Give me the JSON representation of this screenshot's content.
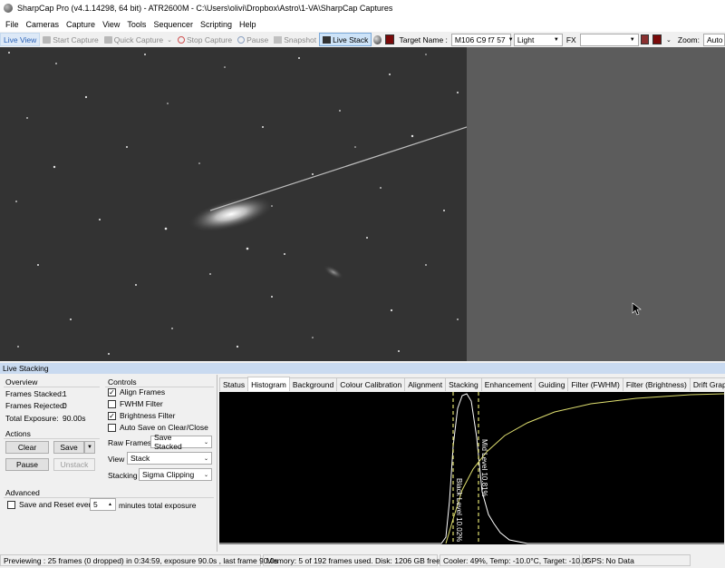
{
  "window": {
    "title": "SharpCap Pro (v4.1.14298, 64 bit) - ATR2600M - C:\\Users\\olivi\\Dropbox\\Astro\\1-VA\\SharpCap Captures"
  },
  "menu": [
    "File",
    "Cameras",
    "Capture",
    "View",
    "Tools",
    "Sequencer",
    "Scripting",
    "Help"
  ],
  "toolbar": {
    "live_view": "Live View",
    "start_capture": "Start Capture",
    "quick_capture": "Quick Capture",
    "stop_capture": "Stop Capture",
    "pause": "Pause",
    "snapshot": "Snapshot",
    "live_stack": "Live Stack",
    "target_name_label": "Target Name :",
    "target_name_value": "M106 C9 f7 57",
    "frame_type": "Light",
    "fx_label": "FX",
    "fx_value": "",
    "zoom_label": "Zoom:",
    "zoom_value": "Auto"
  },
  "live_stacking": {
    "title": "Live Stacking",
    "overview": {
      "heading": "Overview",
      "frames_stacked_label": "Frames Stacked:",
      "frames_stacked": "1",
      "frames_rejected_label": "Frames Rejected:",
      "frames_rejected": "0",
      "total_exposure_label": "Total Exposure:",
      "total_exposure": "90.00s"
    },
    "actions": {
      "heading": "Actions",
      "clear": "Clear",
      "save": "Save",
      "pause": "Pause",
      "unstack": "Unstack"
    },
    "controls": {
      "heading": "Controls",
      "align_frames": "Align Frames",
      "fwhm_filter": "FWHM Filter",
      "brightness_filter": "Brightness Filter",
      "auto_save": "Auto Save on Clear/Close",
      "raw_frames_label": "Raw Frames",
      "raw_frames_value": "Save Stacked",
      "view_label": "View",
      "view_value": "Stack",
      "stacking_label": "Stacking",
      "stacking_value": "Sigma Clipping"
    },
    "advanced": {
      "heading": "Advanced",
      "save_reset_label": "Save and Reset every",
      "save_reset_value": "5",
      "minutes_label": "minutes total exposure"
    },
    "tabs": [
      "Status",
      "Histogram",
      "Background",
      "Colour Calibration",
      "Alignment",
      "Stacking",
      "Enhancement",
      "Guiding",
      "Filter (FWHM)",
      "Filter (Brightness)",
      "Drift Graph"
    ],
    "selected_tab": "Histogram",
    "histogram": {
      "black_level_label": "Black Level 10.02%",
      "mid_level_label": "Mid Level 10.81%"
    }
  },
  "status": {
    "previewing": "Previewing : 25 frames (0 dropped) in 0:34:59, exposure 90.0s , last frame 90.0s",
    "memory": "Memory: 5 of 192 frames used. Disk: 1206 GB free",
    "cooler": "Cooler: 49%, Temp: -10.0°C, Target: -10.0°",
    "gps": "GPS: No Data"
  },
  "colors": {
    "accent": "#2a62b8",
    "histogram_curve": "#e0e070",
    "panel_header": "#c9daf0"
  }
}
